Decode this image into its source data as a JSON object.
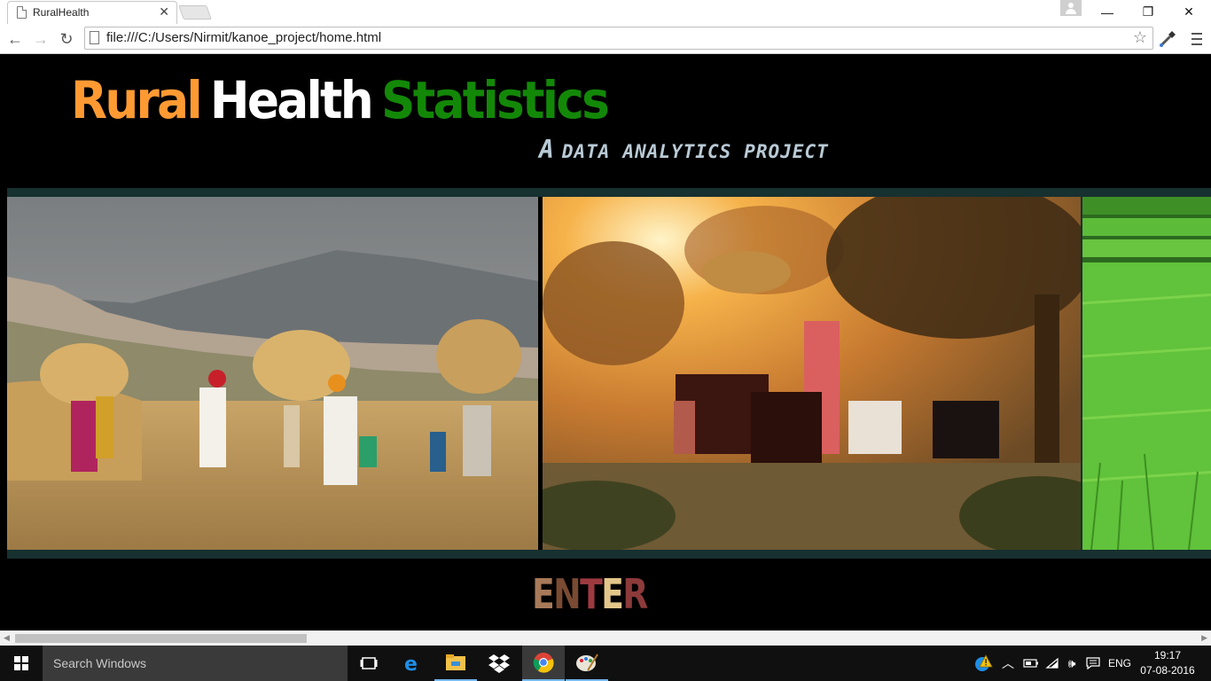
{
  "browser": {
    "tab_title": "RuralHealth",
    "tab_close": "✕",
    "url": "file:///C:/Users/Nirmit/kanoe_project/home.html",
    "window_controls": {
      "minimize": "—",
      "restore": "❐",
      "close": "✕"
    },
    "nav": {
      "back": "←",
      "forward": "→",
      "reload": "↻"
    },
    "bookmark_star": "☆"
  },
  "page": {
    "title_words": [
      "Rural",
      "Health",
      "Statistics"
    ],
    "title_colors": [
      "#ff9a33",
      "#ffffff",
      "#138808"
    ],
    "subtitle_a": "A",
    "subtitle_words": [
      "DATA",
      "ANALYTICS",
      "PROJECT"
    ],
    "slides": [
      {
        "icon": "farmers-carrying-hay-photo"
      },
      {
        "icon": "woman-with-cattle-sunset-photo"
      },
      {
        "icon": "green-rice-field-photo"
      }
    ],
    "enter_letters": [
      "E",
      "N",
      "T",
      "E",
      "R"
    ],
    "enter_colors": [
      "#a87a5a",
      "#7a4a32",
      "#9c3a40",
      "#e3c68a",
      "#8c3a3a"
    ]
  },
  "taskbar": {
    "search_placeholder": "Search Windows",
    "language": "ENG",
    "time": "19:17",
    "date": "07-08-2016",
    "pinned": [
      "task-view-icon",
      "edge-icon",
      "file-explorer-icon",
      "dropbox-icon",
      "chrome-icon",
      "paint-icon"
    ]
  }
}
